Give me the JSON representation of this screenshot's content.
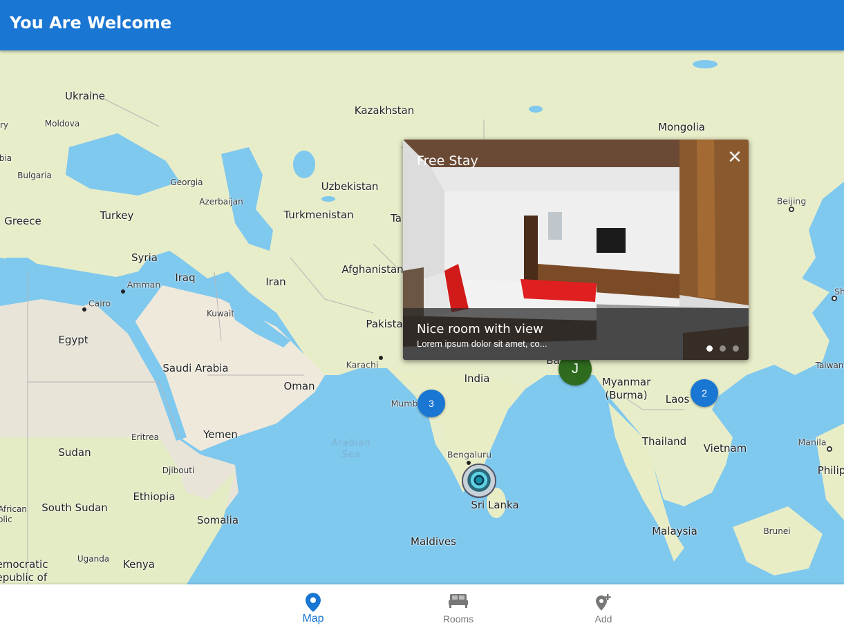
{
  "app_bar": {
    "title": "You Are Welcome",
    "color": "#1976d2"
  },
  "map": {
    "countries": [
      {
        "id": "ukraine",
        "name": "Ukraine"
      },
      {
        "id": "kazakhstan",
        "name": "Kazakhstan"
      },
      {
        "id": "mongolia",
        "name": "Mongolia"
      },
      {
        "id": "moldova",
        "name": "Moldova"
      },
      {
        "id": "bulgaria",
        "name": "Bulgaria"
      },
      {
        "id": "georgia",
        "name": "Georgia"
      },
      {
        "id": "uzbekistan",
        "name": "Uzbekistan"
      },
      {
        "id": "turkey",
        "name": "Turkey"
      },
      {
        "id": "azerbaijan",
        "name": "Azerbaijan"
      },
      {
        "id": "turkmenistan",
        "name": "Turkmenistan"
      },
      {
        "id": "greece",
        "name": "Greece"
      },
      {
        "id": "syria",
        "name": "Syria"
      },
      {
        "id": "afghanistan",
        "name": "Afghanistan"
      },
      {
        "id": "iraq",
        "name": "Iraq"
      },
      {
        "id": "iran",
        "name": "Iran"
      },
      {
        "id": "kuwait",
        "name": "Kuwait"
      },
      {
        "id": "egypt",
        "name": "Egypt"
      },
      {
        "id": "pakistan",
        "name": "Pakista"
      },
      {
        "id": "saudi",
        "name": "Saudi Arabia"
      },
      {
        "id": "india",
        "name": "India"
      },
      {
        "id": "oman",
        "name": "Oman"
      },
      {
        "id": "myanmar",
        "name": "Myanmar\n(Burma)"
      },
      {
        "id": "laos",
        "name": "Laos"
      },
      {
        "id": "taiwan",
        "name": "Taiwan"
      },
      {
        "id": "eritrea",
        "name": "Eritrea"
      },
      {
        "id": "yemen",
        "name": "Yemen"
      },
      {
        "id": "sudan",
        "name": "Sudan"
      },
      {
        "id": "thailand",
        "name": "Thailand"
      },
      {
        "id": "vietnam",
        "name": "Vietnam"
      },
      {
        "id": "djibouti",
        "name": "Djibouti"
      },
      {
        "id": "ethiopia",
        "name": "Ethiopia"
      },
      {
        "id": "south_sudan",
        "name": "South Sudan"
      },
      {
        "id": "somalia",
        "name": "Somalia"
      },
      {
        "id": "srilanka",
        "name": "Sri Lanka"
      },
      {
        "id": "malaysia",
        "name": "Malaysia"
      },
      {
        "id": "brunei",
        "name": "Brunei"
      },
      {
        "id": "maldives",
        "name": "Maldives"
      },
      {
        "id": "uganda",
        "name": "Uganda"
      },
      {
        "id": "kenya",
        "name": "Kenya"
      },
      {
        "id": "dem_congo",
        "name": "emocratic\nepublic of"
      },
      {
        "id": "car",
        "name": "African\nolic"
      },
      {
        "id": "philippines",
        "name": "Philip"
      },
      {
        "id": "tajik",
        "name": "Ta"
      },
      {
        "id": "bangladesh",
        "name": "Ba"
      },
      {
        "id": "ry",
        "name": "ry"
      },
      {
        "id": "bia",
        "name": "bia"
      }
    ],
    "cities": {
      "amman": "Amman",
      "cairo": "Cairo",
      "karachi": "Karachi",
      "mumbai": "Mumb",
      "bengaluru": "Bengaluru",
      "beijing": "Beijing",
      "manila": "Manila",
      "sh": "Sh"
    },
    "sea": "Arabian\nSea",
    "markers": {
      "cluster_mumbai": "3",
      "cluster_laos": "2",
      "user_marker": "J"
    }
  },
  "popup": {
    "title": "Free Stay",
    "close_icon": "close-icon",
    "caption_title": "Nice room with view",
    "caption_text": "Lorem ipsum dolor sit amet, co...",
    "slides_total": 3,
    "active_slide": 1
  },
  "bottom_nav": {
    "items": [
      {
        "label": "Map",
        "icon": "map-pin-icon",
        "active": true
      },
      {
        "label": "Rooms",
        "icon": "bed-icon",
        "active": false
      },
      {
        "label": "Add",
        "icon": "add-location-icon",
        "active": false
      }
    ],
    "active_color": "#1976d2"
  }
}
